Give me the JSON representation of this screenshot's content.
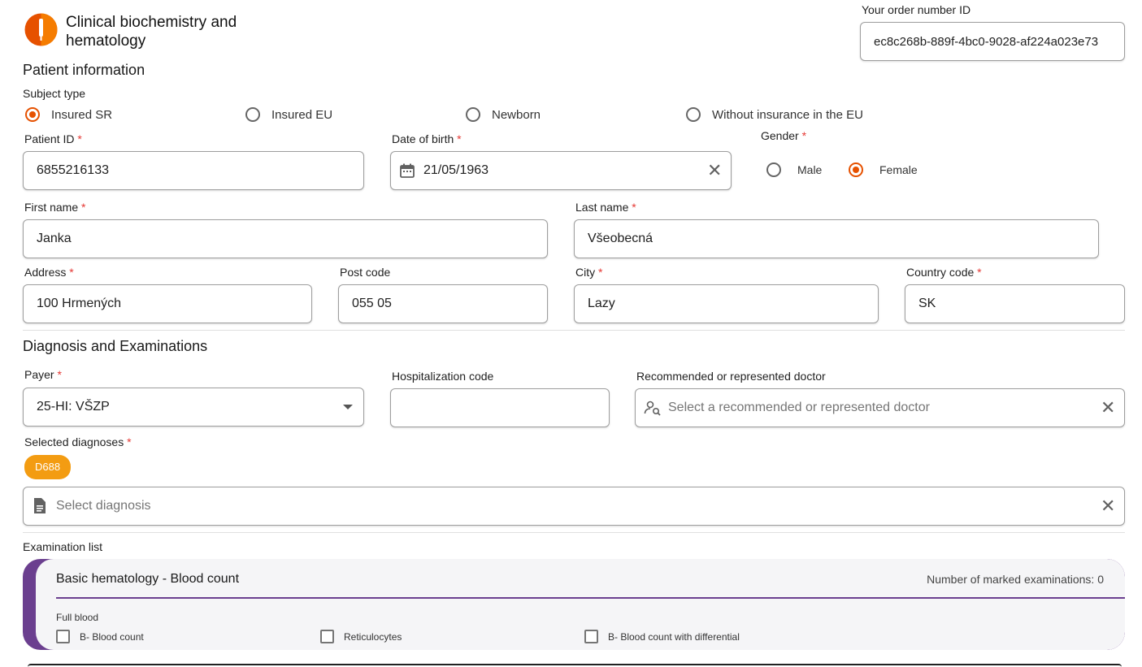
{
  "header": {
    "title": "Clinical biochemistry and hematology",
    "order_label": "Your order number ID",
    "order_value": "ec8c268b-889f-4bc0-9028-af224a023e73"
  },
  "patient": {
    "section_title": "Patient information",
    "subject_type_label": "Subject type",
    "subject_types": [
      {
        "label": "Insured SR",
        "selected": true
      },
      {
        "label": "Insured EU",
        "selected": false
      },
      {
        "label": "Newborn",
        "selected": false
      },
      {
        "label": "Without insurance in the EU",
        "selected": false
      }
    ],
    "patient_id_label": "Patient ID",
    "patient_id": "6855216133",
    "dob_label": "Date of birth",
    "dob": "21/05/1963",
    "gender_label": "Gender",
    "genders": [
      {
        "label": "Male",
        "selected": false
      },
      {
        "label": "Female",
        "selected": true
      }
    ],
    "first_name_label": "First name",
    "first_name": "Janka",
    "last_name_label": "Last name",
    "last_name": "Všeobecná",
    "address_label": "Address",
    "address": "100 Hrmených",
    "post_code_label": "Post code",
    "post_code": "055 05",
    "city_label": "City",
    "city": "Lazy",
    "country_label": "Country code",
    "country": "SK",
    "required_mark": "*"
  },
  "diagnosis": {
    "section_title": "Diagnosis and Examinations",
    "payer_label": "Payer",
    "payer": "25-HI: VŠZP",
    "hosp_label": "Hospitalization code",
    "hosp_value": "",
    "doctor_label": "Recommended or represented doctor",
    "doctor_placeholder": "Select a recommended or represented doctor",
    "selected_diag_label": "Selected diagnoses",
    "selected_diagnoses": [
      "D688"
    ],
    "diag_placeholder": "Select diagnosis"
  },
  "examinations": {
    "list_label": "Examination list",
    "card_title": "Basic hematology - Blood count",
    "marked_count_text": "Number of marked examinations: 0",
    "group_label": "Full blood",
    "items": [
      {
        "label": "B- Blood count",
        "checked": false
      },
      {
        "label": "Reticulocytes",
        "checked": false
      },
      {
        "label": "B- Blood count with differential",
        "checked": false
      }
    ]
  },
  "colors": {
    "accent": "#e65100",
    "chip": "#f39c12",
    "card_stripe": "#6b3f8f",
    "logo": "#e65100"
  }
}
